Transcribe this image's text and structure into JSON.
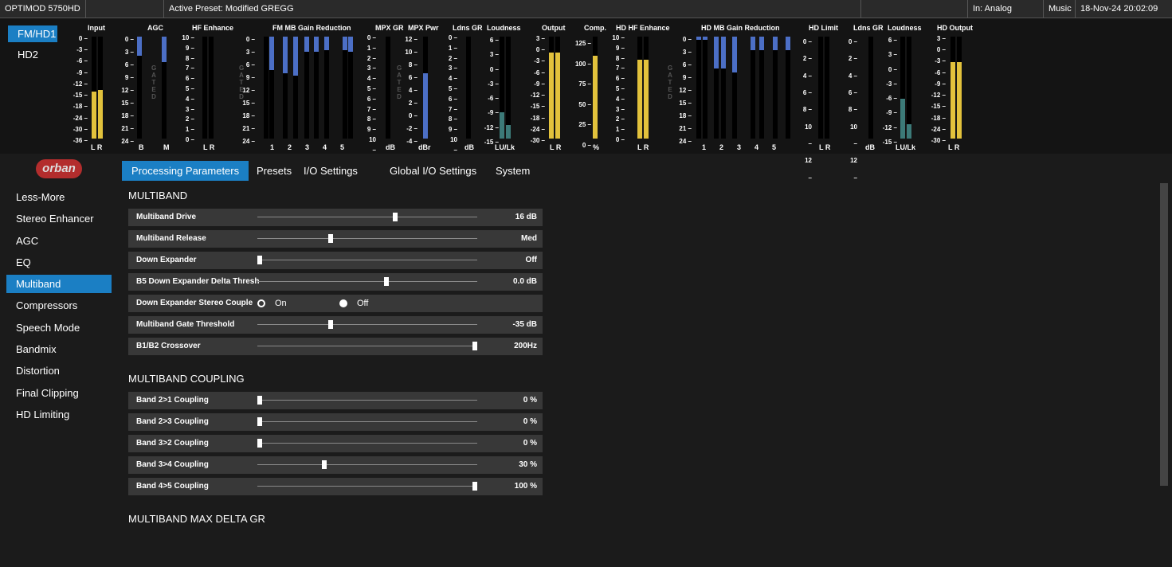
{
  "topbar": {
    "device": "OPTIMOD 5750HD",
    "preset": "Active Preset: Modified GREGG",
    "input": "In: Analog",
    "format": "Music",
    "datetime": "18-Nov-24 20:02:09"
  },
  "modes": [
    "FM/HD1",
    "HD2"
  ],
  "logo_text": "orban",
  "meters": {
    "input": {
      "title": "Input",
      "scale": [
        "0 –",
        "-3 –",
        "-6 –",
        "-9 –",
        "-12 –",
        "-15 –",
        "-18 –",
        "-24 –",
        "-30 –",
        "-36 –"
      ],
      "label": "L R",
      "levels": [
        0.46,
        0.48
      ]
    },
    "agc": {
      "title": "AGC",
      "scale": [
        "0 –",
        "3 –",
        "6 –",
        "9 –",
        "12 –",
        "15 –",
        "18 –",
        "21 –",
        "24 –"
      ],
      "labels": [
        "B",
        "M"
      ],
      "gr": [
        0.19,
        0.25
      ]
    },
    "hf": {
      "title": "HF Enhance",
      "scale": [
        "10 –",
        "9 –",
        "8 –",
        "7 –",
        "6 –",
        "5 –",
        "4 –",
        "3 –",
        "2 –",
        "1 –",
        "0 –"
      ],
      "label": "L R"
    },
    "fmmb": {
      "title": "FM MB Gain Reduction",
      "scale": [
        "0 –",
        "3 –",
        "6 –",
        "9 –",
        "12 –",
        "15 –",
        "18 –",
        "21 –",
        "24 –"
      ],
      "labels": [
        "1",
        "2",
        "3",
        "4",
        "5"
      ],
      "gr": [
        0.0,
        0.33,
        0.36,
        0.38,
        0.15,
        0.15,
        0.13,
        0.13
      ]
    },
    "mpxgr": {
      "title": "MPX GR",
      "scale": [
        "0 –",
        "1 –",
        "2 –",
        "3 –",
        "4 –",
        "5 –",
        "6 –",
        "7 –",
        "8 –",
        "9 –",
        "10 –"
      ],
      "label": "dB"
    },
    "mpxpwr": {
      "title": "MPX Pwr",
      "scale": [
        "12 –",
        "10 –",
        "8 –",
        "6 –",
        "4 –",
        "2 –",
        "0 –",
        "-2 –",
        "-4 –"
      ],
      "label": "dBr",
      "level": 0.64
    },
    "ldnsgr": {
      "title": "Ldns GR",
      "scale": [
        "0 –",
        "1 –",
        "2 –",
        "3 –",
        "4 –",
        "5 –",
        "6 –",
        "7 –",
        "8 –",
        "9 –",
        "10 –"
      ],
      "label": "dB"
    },
    "loudness": {
      "title": "Loudness",
      "scale": [
        "6 –",
        "3 –",
        "0 –",
        "-3 –",
        "-6 –",
        "-9 –",
        "-12 –",
        "-15 –"
      ],
      "label": "LU/Lk",
      "levels": [
        0.26,
        0.13
      ]
    },
    "output": {
      "title": "Output",
      "scale": [
        "3 –",
        "0 –",
        "-3 –",
        "-6 –",
        "-9 –",
        "-12 –",
        "-15 –",
        "-18 –",
        "-24 –",
        "-30 –"
      ],
      "label": "L R",
      "levels": [
        0.84,
        0.84
      ]
    },
    "comp": {
      "title": "Comp.",
      "scale": [
        "125 –",
        "100 –",
        "75 –",
        "50 –",
        "25 –",
        "0 –"
      ],
      "label": "%",
      "level": 0.81
    },
    "hdhf": {
      "title": "HD HF Enhance",
      "scale": [
        "10 –",
        "9 –",
        "8 –",
        "7 –",
        "6 –",
        "5 –",
        "4 –",
        "3 –",
        "2 –",
        "1 –",
        "0 –"
      ],
      "label": "L R",
      "levels": [
        0.77,
        0.77
      ]
    },
    "hdmb": {
      "title": "HD MB Gain Reduction",
      "scale": [
        "0 –",
        "3 –",
        "6 –",
        "9 –",
        "12 –",
        "15 –",
        "18 –",
        "21 –",
        "24 –"
      ],
      "labels": [
        "1",
        "2",
        "3",
        "4",
        "5"
      ],
      "gr": [
        0.03,
        0.03,
        0.31,
        0.31,
        0.35,
        0.13,
        0.13,
        0.13
      ]
    },
    "hdlimit": {
      "title": "HD Limit",
      "scale": [
        "0 –",
        "2 –",
        "4 –",
        "6 –",
        "8 –",
        "10 –",
        "12 –"
      ],
      "label": "L R"
    },
    "hdldnsgr": {
      "title": "Ldns GR",
      "scale": [
        "0 –",
        "2 –",
        "4 –",
        "6 –",
        "8 –",
        "10 –",
        "12 –"
      ],
      "label": "dB"
    },
    "hdloud": {
      "title": "Loudness",
      "scale": [
        "6 –",
        "3 –",
        "0 –",
        "-3 –",
        "-6 –",
        "-9 –",
        "-12 –",
        "-15 –"
      ],
      "label": "LU/Lk",
      "levels": [
        0.39,
        0.14
      ]
    },
    "hdout": {
      "title": "HD Output",
      "scale": [
        "3 –",
        "0 –",
        "-3 –",
        "-6 –",
        "-9 –",
        "-12 –",
        "-15 –",
        "-18 –",
        "-24 –",
        "-30 –"
      ],
      "label": "L R",
      "levels": [
        0.75,
        0.75
      ]
    }
  },
  "gated_text": "GATED",
  "tabs": [
    "Processing Parameters",
    "Presets",
    "I/O Settings",
    "Global I/O Settings",
    "System"
  ],
  "sidebar": [
    "Less-More",
    "Stereo Enhancer",
    "AGC",
    "EQ",
    "Multiband",
    "Compressors",
    "Speech Mode",
    "Bandmix",
    "Distortion",
    "Final Clipping",
    "HD Limiting"
  ],
  "sections": {
    "multiband": {
      "title": "MULTIBAND",
      "rows": [
        {
          "label": "Multiband Drive",
          "value": "16 dB",
          "pos": 0.63
        },
        {
          "label": "Multiband Release",
          "value": "Med",
          "pos": 0.33
        },
        {
          "label": "Down Expander",
          "value": "Off",
          "pos": 0.0
        },
        {
          "label": "B5 Down Expander Delta Thresh",
          "value": "0.0 dB",
          "pos": 0.59
        }
      ],
      "radio": {
        "label": "Down Expander Stereo Couple",
        "on": "On",
        "off": "Off",
        "selected": "Off"
      },
      "rows2": [
        {
          "label": "Multiband Gate Threshold",
          "value": "-35 dB",
          "pos": 0.33
        },
        {
          "label": "B1/B2 Crossover",
          "value": "200Hz",
          "pos": 1.0
        }
      ]
    },
    "coupling": {
      "title": "MULTIBAND COUPLING",
      "rows": [
        {
          "label": "Band 2>1 Coupling",
          "value": "0 %",
          "pos": 0.0
        },
        {
          "label": "Band 2>3 Coupling",
          "value": "0 %",
          "pos": 0.0
        },
        {
          "label": "Band 3>2 Coupling",
          "value": "0 %",
          "pos": 0.0
        },
        {
          "label": "Band 3>4 Coupling",
          "value": "30 %",
          "pos": 0.3
        },
        {
          "label": "Band 4>5 Coupling",
          "value": "100 %",
          "pos": 1.0
        }
      ]
    },
    "maxdelta": {
      "title": "MULTIBAND MAX DELTA GR"
    }
  }
}
